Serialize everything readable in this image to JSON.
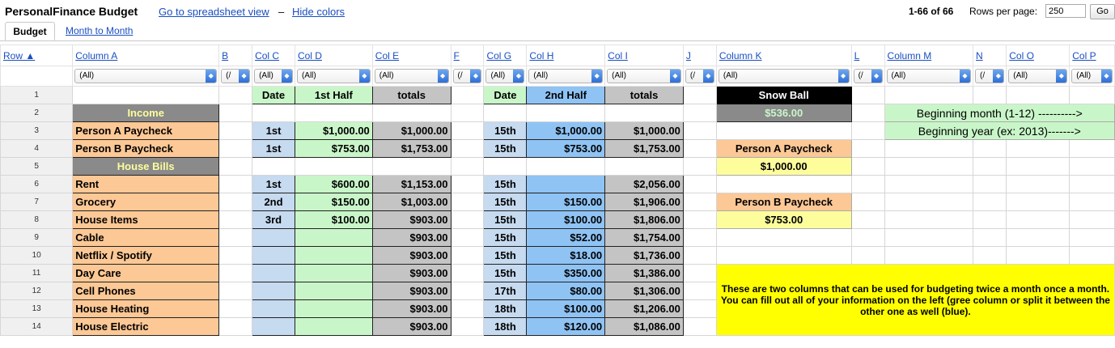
{
  "app": {
    "title": "PersonalFinance Budget",
    "link_spreadsheet": "Go to spreadsheet view",
    "separator": "–",
    "link_hide_colors": "Hide colors"
  },
  "pager": {
    "range": "1-66 of 66",
    "rows_label": "Rows per page:",
    "rows_value": "250",
    "go_label": "Go"
  },
  "tabs": [
    {
      "label": "Budget",
      "active": true
    },
    {
      "label": "Month to Month",
      "active": false
    }
  ],
  "columns": {
    "row": "Row ▲",
    "a": "Column A",
    "b": "B",
    "c": "Col C",
    "d": "Col D",
    "e": "Col E",
    "f": "F",
    "g": "Col G",
    "h": "Col H",
    "i": "Col I",
    "j": "J",
    "k": "Column K",
    "l": "L",
    "m": "Column M",
    "n": "N",
    "o": "Col O",
    "p": "Col P"
  },
  "filters": {
    "all": "(All)",
    "short": "(/"
  },
  "rows": {
    "r1": {
      "num": "1",
      "c": "Date",
      "d": "1st Half",
      "e": "totals",
      "g": "Date",
      "h": "2nd Half",
      "i": "totals",
      "k": "Snow Ball"
    },
    "r2": {
      "num": "2",
      "a": "Income",
      "k": "$536.00",
      "m": "Beginning month (1-12) ---------->"
    },
    "r3": {
      "num": "3",
      "a": "Person A Paycheck",
      "c": "1st",
      "d": "$1,000.00",
      "e": "$1,000.00",
      "g": "15th",
      "h": "$1,000.00",
      "i": "$1,000.00",
      "m": "Beginning year (ex: 2013)------->"
    },
    "r4": {
      "num": "4",
      "a": "Person B Paycheck",
      "c": "1st",
      "d": "$753.00",
      "e": "$1,753.00",
      "g": "15th",
      "h": "$753.00",
      "i": "$1,753.00",
      "k": "Person A Paycheck"
    },
    "r5": {
      "num": "5",
      "a": "House Bills",
      "k": "$1,000.00"
    },
    "r6": {
      "num": "6",
      "a": "Rent",
      "c": "1st",
      "d": "$600.00",
      "e": "$1,153.00",
      "g": "15th",
      "h": "",
      "i": "$2,056.00"
    },
    "r7": {
      "num": "7",
      "a": "Grocery",
      "c": "2nd",
      "d": "$150.00",
      "e": "$1,003.00",
      "g": "15th",
      "h": "$150.00",
      "i": "$1,906.00",
      "k": "Person B Paycheck"
    },
    "r8": {
      "num": "8",
      "a": "House Items",
      "c": "3rd",
      "d": "$100.00",
      "e": "$903.00",
      "g": "15th",
      "h": "$100.00",
      "i": "$1,806.00",
      "k": "$753.00"
    },
    "r9": {
      "num": "9",
      "a": "Cable",
      "c": "",
      "d": "",
      "e": "$903.00",
      "g": "15th",
      "h": "$52.00",
      "i": "$1,754.00"
    },
    "r10": {
      "num": "10",
      "a": "Netflix / Spotify",
      "c": "",
      "d": "",
      "e": "$903.00",
      "g": "15th",
      "h": "$18.00",
      "i": "$1,736.00"
    },
    "r11": {
      "num": "11",
      "a": "Day Care",
      "c": "",
      "d": "",
      "e": "$903.00",
      "g": "15th",
      "h": "$350.00",
      "i": "$1,386.00"
    },
    "r12": {
      "num": "12",
      "a": "Cell Phones",
      "c": "",
      "d": "",
      "e": "$903.00",
      "g": "17th",
      "h": "$80.00",
      "i": "$1,306.00"
    },
    "r13": {
      "num": "13",
      "a": "House Heating",
      "c": "",
      "d": "",
      "e": "$903.00",
      "g": "18th",
      "h": "$100.00",
      "i": "$1,206.00"
    },
    "r14": {
      "num": "14",
      "a": "House Electric",
      "c": "",
      "d": "",
      "e": "$903.00",
      "g": "18th",
      "h": "$120.00",
      "i": "$1,086.00"
    }
  },
  "note": "These are two columns that can be used for budgeting twice a month once a month. You can fill out all of your information on the left (gree column or split it between the other one as well (blue).",
  "colors": {
    "link": "#1a4fc0",
    "orange": "#fcc895",
    "green": "#c9f6c9",
    "blue": "#8fc3f4",
    "light_blue": "#c6daf0",
    "gray": "#c4c4c4",
    "dark_gray": "#8a8a8a",
    "yellow_text": "#fdfd9c",
    "yellow": "#ffff00",
    "black": "#000000"
  }
}
